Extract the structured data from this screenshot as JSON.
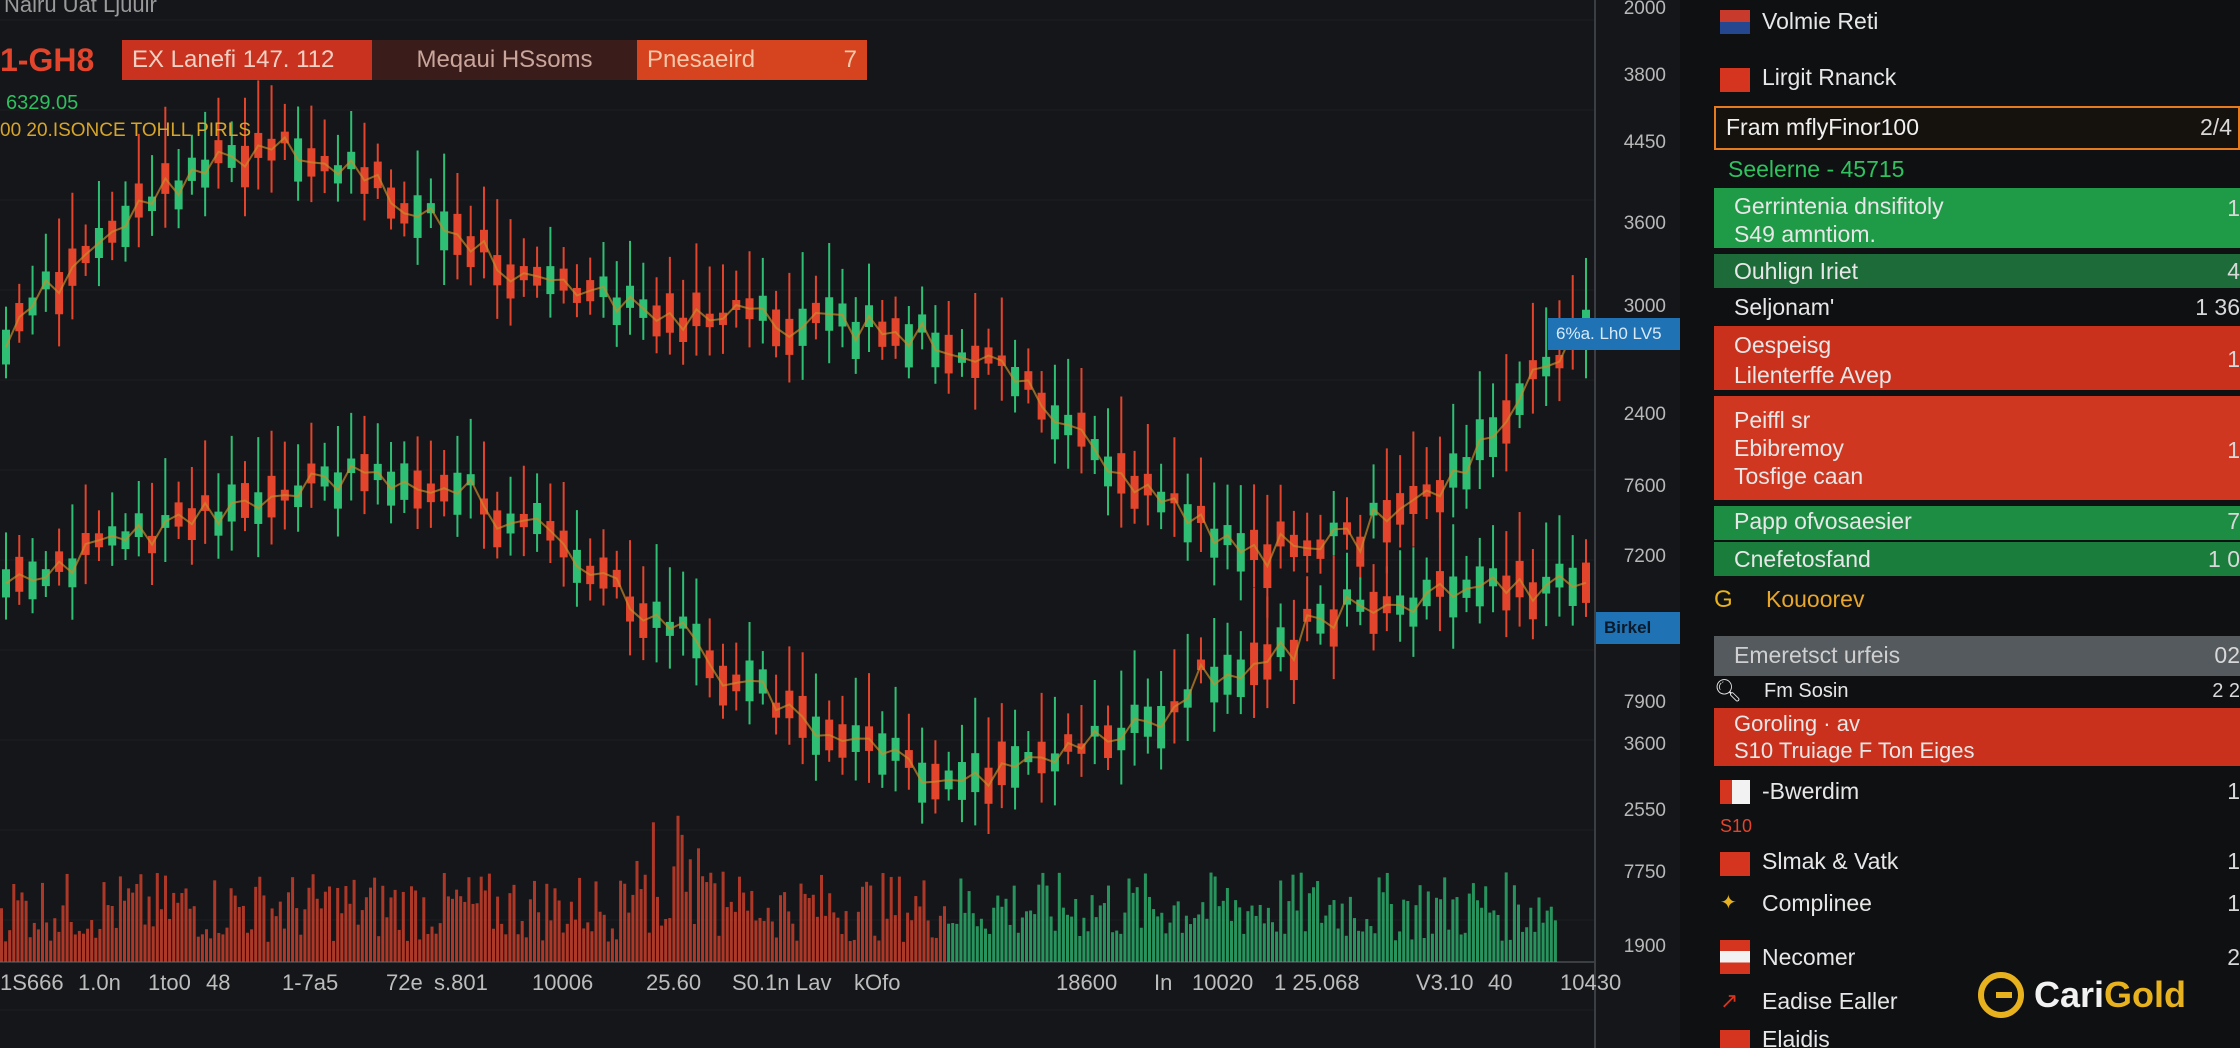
{
  "header": {
    "title": "Nairu Uat Ljuuir",
    "price": "1-GH8",
    "sub_green": "6329.05",
    "sub_yellow": "00 20.ISONCE   TOHLL  PIRLS"
  },
  "badges": {
    "b1": "EX Lanefi 147. 112",
    "b2": "Meqaui HSsoms",
    "b3_label": "Pnesaeird",
    "b3_num": "7"
  },
  "price_axis": [
    "2000",
    "3800",
    "4450",
    "3600",
    "3000",
    "2400",
    "7600",
    "7200",
    "7900",
    "3600",
    "2550",
    "7750",
    "1900"
  ],
  "price_tags": {
    "current": "6%a. Lh0 LV5",
    "marker": "Birkel"
  },
  "time_axis": [
    "1S666",
    "1.0n",
    "1to0",
    "48",
    "1-7a5",
    "72e",
    "s.801",
    "10006",
    "25.60",
    "S0.1n",
    "Lav",
    "kOfo",
    "18600",
    "In",
    "10020",
    "1 25.068",
    "V3.10",
    "40",
    "10430"
  ],
  "colors": {
    "up": "#2fbf74",
    "down": "#e2442c",
    "accent": "#e8b21e",
    "tag": "#1f73b4"
  },
  "sidebar": {
    "items": [
      {
        "label": "Volmie Reti",
        "value": ""
      },
      {
        "label": "Lirgit Rnanck",
        "value": ""
      },
      {
        "label": "Fram mflyFinor100",
        "value": "2/4"
      },
      {
        "label": "Seelerne - 45715",
        "value": ""
      },
      {
        "label": "Gerrintenia dnsifitoly",
        "label2": "S49 amntiom.",
        "value": "1"
      },
      {
        "label": "Ouhlign Iriet",
        "value": "4"
      },
      {
        "label": "Seljonam'",
        "value": "1 36"
      },
      {
        "label": "Oespeisg",
        "label2": "Lilenterffe Avep",
        "value": "1"
      },
      {
        "label": "Peiffl sr",
        "label2": "Ebibremoy",
        "label3": "Tosfige caan",
        "value": "1"
      },
      {
        "label": "Papp ofvosaesier",
        "value": "7"
      },
      {
        "label": "Cnefetosfand",
        "value": "1 0"
      },
      {
        "label": "Kouoorev",
        "value": ""
      },
      {
        "label": "Emeretsct urfeis",
        "value": "02"
      },
      {
        "label": "Fm Sosin",
        "value": "2 2"
      },
      {
        "label": "Goroling · av",
        "label2": "S10 Truiage F Ton Eiges",
        "value": ""
      },
      {
        "label": "-Bwerdim",
        "value": "1"
      },
      {
        "label": "S10",
        "value": ""
      },
      {
        "label": "Slmak & Vatk",
        "value": "1"
      },
      {
        "label": "Complinee",
        "value": "1"
      },
      {
        "label": "Necomer",
        "value": "2"
      },
      {
        "label": "Eadise Ealler",
        "value": ""
      },
      {
        "label": "Elaidis",
        "value": ""
      }
    ]
  },
  "logo": {
    "part1": "Cari",
    "part2": "Gold"
  }
}
